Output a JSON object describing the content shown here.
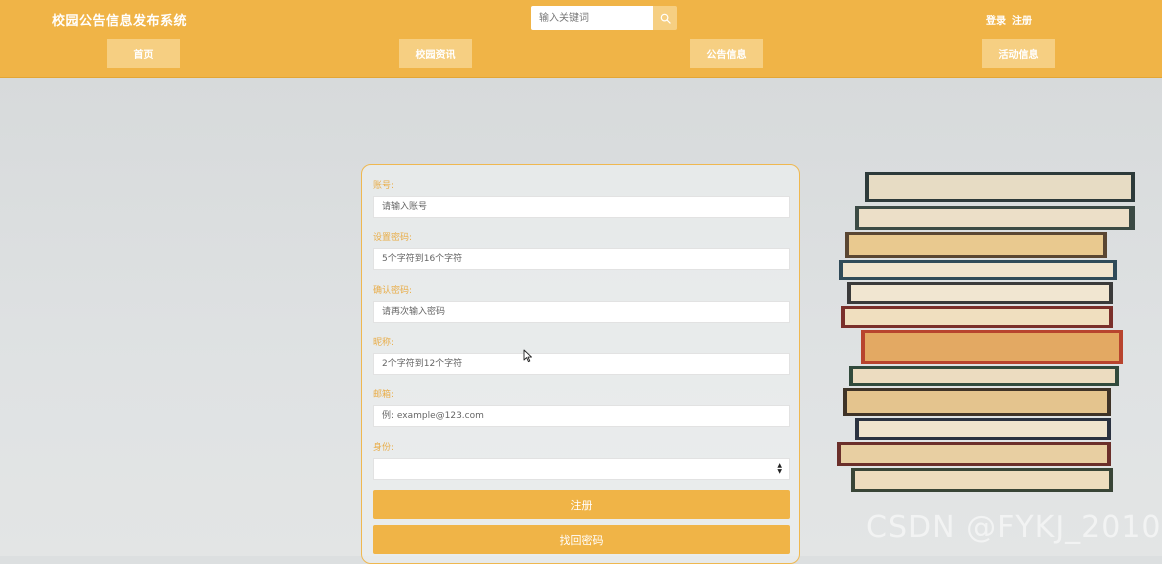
{
  "header": {
    "site_title": "校园公告信息发布系统",
    "search": {
      "placeholder": "输入关键词",
      "icon": "search-icon"
    },
    "auth": {
      "login": "登录",
      "register": "注册"
    },
    "nav": [
      "首页",
      "校园资讯",
      "公告信息",
      "活动信息"
    ]
  },
  "form": {
    "fields": [
      {
        "label": "账号:",
        "placeholder": "请输入账号"
      },
      {
        "label": "设置密码:",
        "placeholder": "5个字符到16个字符"
      },
      {
        "label": "确认密码:",
        "placeholder": "请再次输入密码"
      },
      {
        "label": "昵称:",
        "placeholder": "2个字符到12个字符"
      },
      {
        "label": "邮箱:",
        "placeholder": "例: example@123.com"
      }
    ],
    "identity": {
      "label": "身份:",
      "selected": ""
    },
    "register_button": "注册",
    "recover_button": "找回密码"
  },
  "watermark": "CSDN @FYKJ_2010",
  "colors": {
    "accent": "#f0b447",
    "nav_button": "#f6cf82",
    "label": "#e9ad48",
    "background": "#dcdfe0"
  }
}
